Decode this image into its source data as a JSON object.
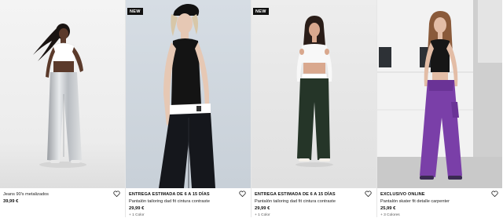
{
  "products": [
    {
      "badge": "",
      "tag": "",
      "name": "Jeans 90's metalizados",
      "price": "39,99 €",
      "colors": "",
      "fav_icon": "heart-icon"
    },
    {
      "badge": "NEW",
      "tag": "ENTREGA ESTIMADA DE 6 A 15 DÍAS",
      "name": "Pantalón tailoring dad fit cintura contraste",
      "price": "29,99 €",
      "colors": "+ 1 Color",
      "fav_icon": "heart-icon"
    },
    {
      "badge": "NEW",
      "tag": "ENTREGA ESTIMADA DE 6 A 15 DÍAS",
      "name": "Pantalón tailoring dad fit cintura contraste",
      "price": "29,99 €",
      "colors": "+ 1 Color",
      "fav_icon": "heart-icon"
    },
    {
      "badge": "",
      "tag": "EXCLUSIVO ONLINE",
      "name": "Pantalón skater fit detalle carpenter",
      "price": "25,99 €",
      "colors": "+ 3 Colores",
      "fav_icon": "heart-icon"
    }
  ],
  "colors": {
    "badge_bg": "#111111",
    "text": "#111111",
    "subtext": "#555555"
  }
}
